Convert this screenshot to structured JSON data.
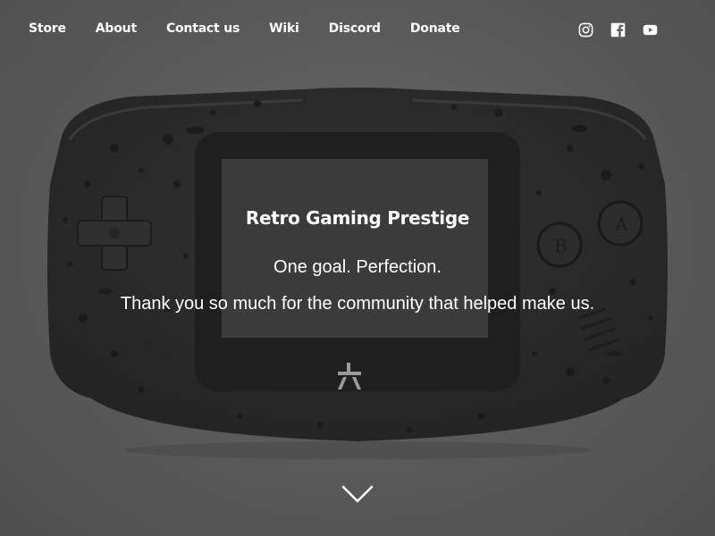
{
  "nav": {
    "links": [
      {
        "label": "Store"
      },
      {
        "label": "About"
      },
      {
        "label": "Contact us"
      },
      {
        "label": "Wiki"
      },
      {
        "label": "Discord"
      },
      {
        "label": "Donate"
      }
    ],
    "social": [
      {
        "icon": "instagram-icon"
      },
      {
        "icon": "facebook-icon"
      },
      {
        "icon": "youtube-icon"
      }
    ]
  },
  "hero": {
    "title": "Retro Gaming Prestige",
    "tagline": "One goal. Perfection.",
    "thanks": "Thank you so much for the community that helped make us.",
    "scroll_icon": "chevron-down-icon"
  },
  "colors": {
    "background": "#5c5c5c",
    "console_shell": "#2b2b2b",
    "screen": "#3c3c3c",
    "text": "#ffffff"
  }
}
